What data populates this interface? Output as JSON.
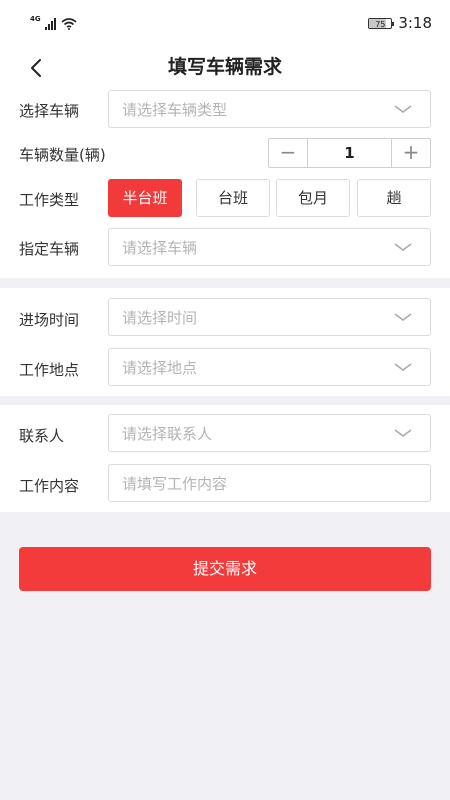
{
  "status_bar": {
    "network": "4G",
    "battery": "75",
    "battery_level": 0.75,
    "time": "3:18"
  },
  "header": {
    "title": "填写车辆需求"
  },
  "form": {
    "vehicle": {
      "label": "选择车辆",
      "placeholder": "请选择车辆类型"
    },
    "quantity": {
      "label": "车辆数量(辆)",
      "value": "1",
      "minus": "−",
      "plus": "+"
    },
    "work_type": {
      "label": "工作类型",
      "options": [
        "半台班",
        "台班",
        "包月",
        "趟"
      ],
      "selected_index": 0
    },
    "specified_vehicle": {
      "label": "指定车辆",
      "placeholder": "请选择车辆"
    },
    "entry_time": {
      "label": "进场时间",
      "placeholder": "请选择时间"
    },
    "location": {
      "label": "工作地点",
      "placeholder": "请选择地点"
    },
    "contact": {
      "label": "联系人",
      "placeholder": "请选择联系人"
    },
    "content": {
      "label": "工作内容",
      "placeholder": "请填写工作内容"
    }
  },
  "submit": {
    "label": "提交需求"
  },
  "colors": {
    "accent": "#f23a3a",
    "background": "#f1f1f5",
    "placeholder": "#b4b4b4"
  },
  "icons": {
    "back": "chevron-left-icon",
    "dropdown": "chevron-down-icon",
    "signal": "signal-icon",
    "wifi": "wifi-icon"
  }
}
